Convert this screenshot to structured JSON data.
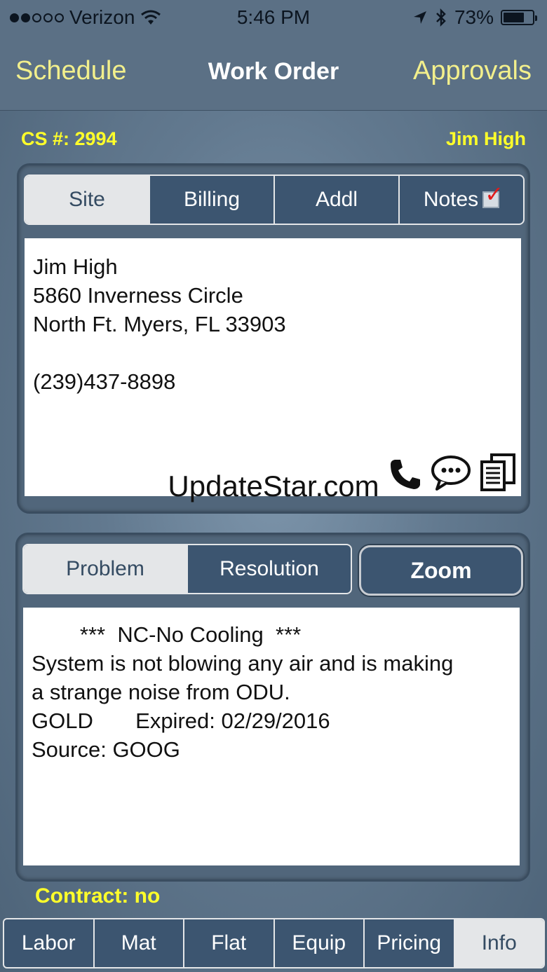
{
  "status_bar": {
    "carrier": "Verizon",
    "signal_bars_filled": 2,
    "signal_bars_total": 5,
    "time": "5:46 PM",
    "battery": "73%",
    "battery_level": 0.73
  },
  "nav": {
    "left": "Schedule",
    "title": "Work Order",
    "right": "Approvals"
  },
  "cs": {
    "label": "CS #:  2994",
    "customer": "Jim High"
  },
  "site_tabs": [
    {
      "label": "Site",
      "active": true
    },
    {
      "label": "Billing",
      "active": false
    },
    {
      "label": "Addl",
      "active": false
    },
    {
      "label": "Notes",
      "active": false
    }
  ],
  "site": {
    "lines": [
      "Jim High",
      "5860 Inverness Circle",
      "North Ft. Myers, FL 33903",
      "",
      "(239)437-8898"
    ]
  },
  "watermark": "UpdateStar.com",
  "problem_tabs": [
    {
      "label": "Problem",
      "active": true
    },
    {
      "label": "Resolution",
      "active": false
    }
  ],
  "zoom_label": "Zoom",
  "problem": {
    "lines": [
      "        ***  NC-No Cooling  ***",
      "System is not blowing any air and is making",
      "a strange noise from ODU.",
      "GOLD       Expired: 02/29/2016",
      "Source: GOOG"
    ]
  },
  "contract": "Contract:  no",
  "bottom_tabs": [
    {
      "label": "Labor",
      "active": false
    },
    {
      "label": "Mat",
      "active": false
    },
    {
      "label": "Flat",
      "active": false
    },
    {
      "label": "Equip",
      "active": false
    },
    {
      "label": "Pricing",
      "active": false
    },
    {
      "label": "Info",
      "active": true
    }
  ],
  "colors": {
    "accent_yellow": "#ffff2a",
    "nav_link": "#f2ef8c",
    "segment_dark": "#3c5570",
    "segment_light": "#e4e6e8"
  }
}
